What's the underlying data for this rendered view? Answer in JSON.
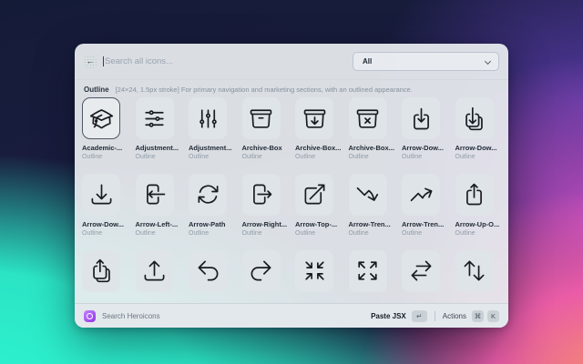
{
  "window": {
    "search": {
      "back_glyph": "←",
      "placeholder": "Search all icons..."
    },
    "filter": {
      "value": "All"
    },
    "section": {
      "title": "Outline",
      "description": "[24×24, 1.5px stroke] For primary navigation and marketing sections, with an outlined appearance."
    },
    "icons": [
      {
        "name": "Academic-...",
        "variant": "Outline",
        "icon": "academic-cap",
        "selected": true
      },
      {
        "name": "Adjustment...",
        "variant": "Outline",
        "icon": "adjustments-horizontal"
      },
      {
        "name": "Adjustment...",
        "variant": "Outline",
        "icon": "adjustments-vertical"
      },
      {
        "name": "Archive-Box",
        "variant": "Outline",
        "icon": "archive-box"
      },
      {
        "name": "Archive-Box...",
        "variant": "Outline",
        "icon": "archive-box-arrow-down"
      },
      {
        "name": "Archive-Box...",
        "variant": "Outline",
        "icon": "archive-box-x-mark"
      },
      {
        "name": "Arrow-Dow...",
        "variant": "Outline",
        "icon": "arrow-down-on-square"
      },
      {
        "name": "Arrow-Dow...",
        "variant": "Outline",
        "icon": "arrow-down-on-square-stack"
      },
      {
        "name": "Arrow-Dow...",
        "variant": "Outline",
        "icon": "arrow-down-tray"
      },
      {
        "name": "Arrow-Left-...",
        "variant": "Outline",
        "icon": "arrow-left-on-rectangle"
      },
      {
        "name": "Arrow-Path",
        "variant": "Outline",
        "icon": "arrow-path"
      },
      {
        "name": "Arrow-Right...",
        "variant": "Outline",
        "icon": "arrow-right-on-rectangle"
      },
      {
        "name": "Arrow-Top-...",
        "variant": "Outline",
        "icon": "arrow-top-right-on-square"
      },
      {
        "name": "Arrow-Tren...",
        "variant": "Outline",
        "icon": "arrow-trending-down"
      },
      {
        "name": "Arrow-Tren...",
        "variant": "Outline",
        "icon": "arrow-trending-up"
      },
      {
        "name": "Arrow-Up-O...",
        "variant": "Outline",
        "icon": "arrow-up-on-square"
      },
      {
        "name": "",
        "variant": "",
        "icon": "arrow-up-on-square-stack"
      },
      {
        "name": "",
        "variant": "",
        "icon": "arrow-up-tray"
      },
      {
        "name": "",
        "variant": "",
        "icon": "arrow-uturn-left"
      },
      {
        "name": "",
        "variant": "",
        "icon": "arrow-uturn-right"
      },
      {
        "name": "",
        "variant": "",
        "icon": "arrows-pointing-in"
      },
      {
        "name": "",
        "variant": "",
        "icon": "arrows-pointing-out"
      },
      {
        "name": "",
        "variant": "",
        "icon": "arrows-right-left"
      },
      {
        "name": "",
        "variant": "",
        "icon": "arrows-up-down"
      }
    ],
    "footer": {
      "brand_label": "Search Heroicons",
      "primary_action": "Paste JSX",
      "primary_key": "↵",
      "secondary_action": "Actions",
      "secondary_key_1": "⌘",
      "secondary_key_2": "K"
    },
    "colors": {
      "accent_purple": "#9333ea",
      "bg_teal": "#2bf0cd",
      "bg_pink": "#f45faa",
      "bg_navy": "#151c38",
      "panel": "#e9edf0"
    }
  }
}
